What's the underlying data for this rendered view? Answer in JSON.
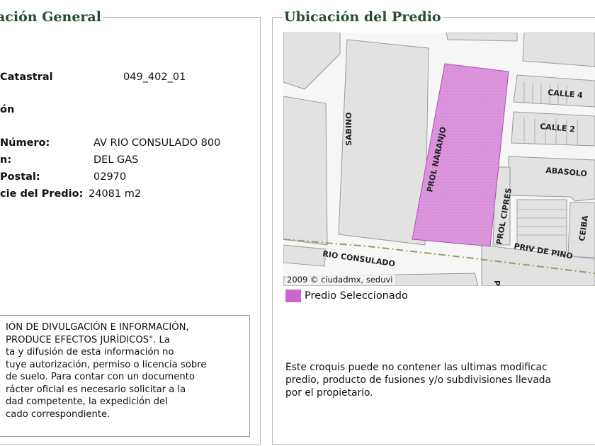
{
  "left_panel": {
    "title": "ación General",
    "clave_label": "Catastral",
    "clave_value": "049_402_01",
    "section_heading": "ón",
    "rows": [
      {
        "label": "Número:",
        "value": "AV RIO CONSULADO 800"
      },
      {
        "label": "n:",
        "value": "DEL GAS"
      },
      {
        "label": "Postal:",
        "value": "02970"
      },
      {
        "label": "cie del Predio:",
        "value": "24081 m2"
      }
    ],
    "disclaimer_lines": [
      "IÓN DE DIVULGACIÓN E INFORMACIÓN,",
      "PRODUCE EFECTOS JURÍDICOS\". La",
      "ta y difusión de esta información no",
      "tuye autorización, permiso o licencia sobre",
      "de suelo. Para contar con un documento",
      "rácter oficial es necesario solicitar a la",
      "dad competente, la expedición del",
      "cado correspondiente."
    ]
  },
  "right_panel": {
    "title": "Ubicación del Predio",
    "map_labels": {
      "calle4": "CALLE 4",
      "calle2": "CALLE 2",
      "abasolo": "ABASOLO",
      "sabino": "SABINO",
      "prol_naranjo": "PROL NARANJO",
      "prol_cipres": "PROL CIPRES",
      "ceiba": "CEIBA",
      "priv_de_pino": "PRIV DE PINO",
      "rio_consulado": "RIO CONSULADO",
      "pres": "PRES"
    },
    "copyright": "2009 © ciudadmx, seduvi",
    "legend_label": "Predio Seleccionado",
    "legend_color": "#cc66cc",
    "note_lines": [
      "Este croquis puede no contener las ultimas modificac",
      "predio, producto de fusiones y/o subdivisiones llevada",
      "por el propietario."
    ]
  }
}
